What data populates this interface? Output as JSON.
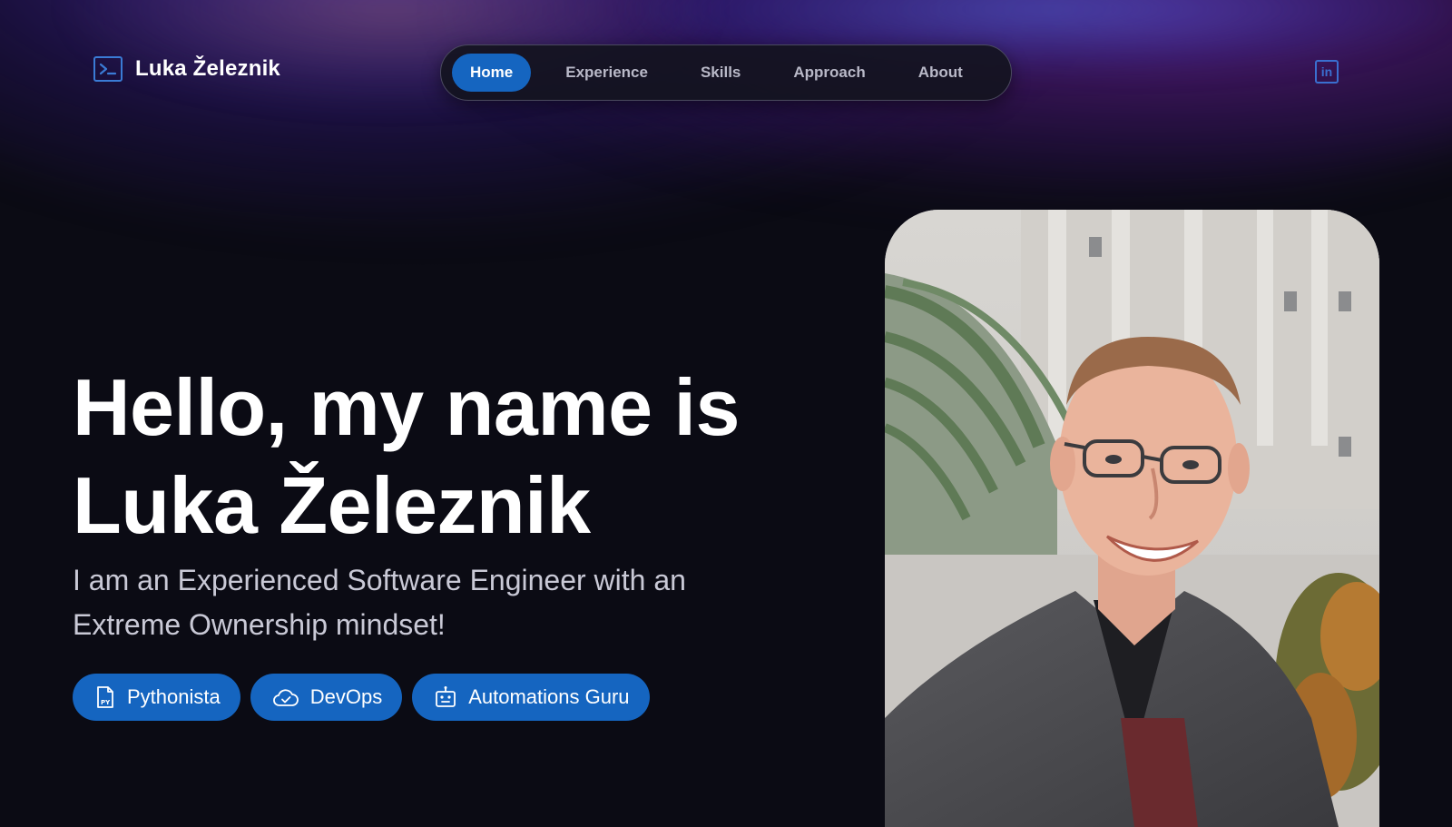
{
  "brand": {
    "name": "Luka Železnik",
    "icon": "terminal-icon"
  },
  "nav": {
    "items": [
      {
        "label": "Home",
        "active": true
      },
      {
        "label": "Experience",
        "active": false
      },
      {
        "label": "Skills",
        "active": false
      },
      {
        "label": "Approach",
        "active": false
      },
      {
        "label": "About",
        "active": false
      }
    ]
  },
  "social": {
    "linkedin_icon": "linkedin-icon",
    "linkedin_text": "in"
  },
  "hero": {
    "title_line1": "Hello, my name is",
    "title_line2": "Luka Železnik",
    "subtitle": "I am an Experienced Software Engineer with an Extreme Ownership mindset!",
    "chips": [
      {
        "label": "Pythonista",
        "icon": "python-file-icon"
      },
      {
        "label": "DevOps",
        "icon": "cloud-check-icon"
      },
      {
        "label": "Automations Guru",
        "icon": "robot-icon"
      }
    ]
  },
  "colors": {
    "accent": "#1565c0",
    "background": "#0b0b14",
    "text": "#ffffff",
    "muted_text": "#c9c9d6"
  }
}
